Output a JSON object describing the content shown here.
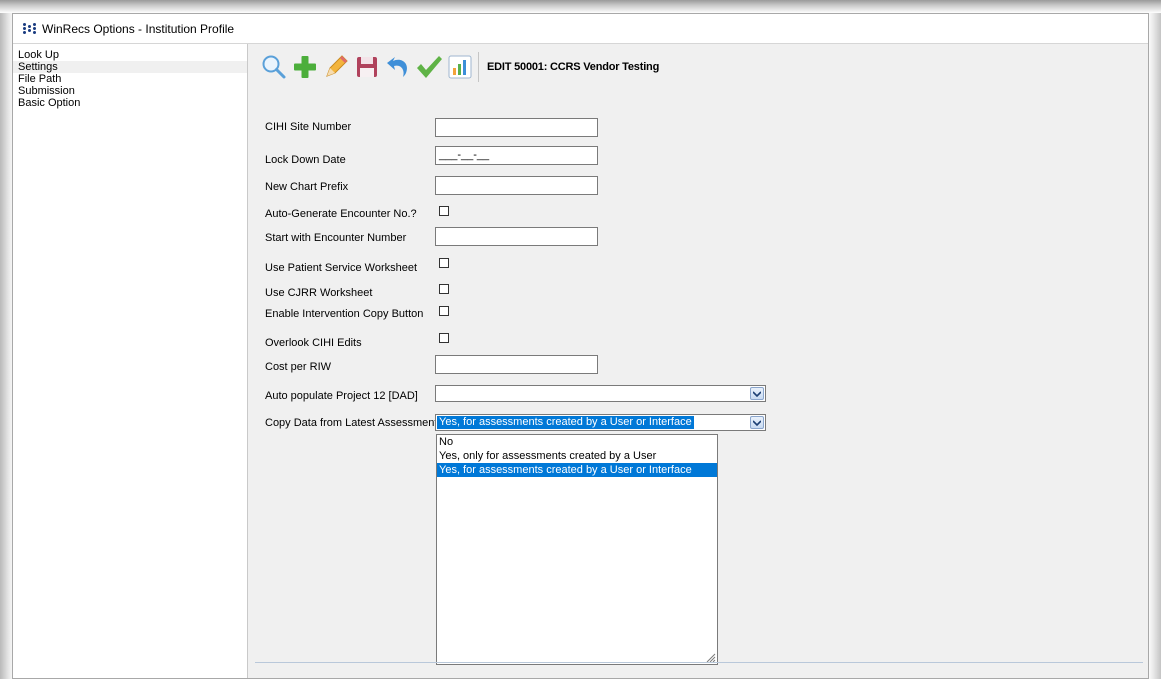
{
  "window": {
    "title": "WinRecs Options - Institution Profile"
  },
  "sidebar": {
    "items": [
      {
        "label": "Look Up"
      },
      {
        "label": "Settings"
      },
      {
        "label": "File Path"
      },
      {
        "label": "Submission"
      },
      {
        "label": "Basic Option"
      }
    ]
  },
  "toolbar": {
    "title": "EDIT 50001: CCRS Vendor Testing",
    "buttons": [
      "search-icon",
      "add-icon",
      "edit-icon",
      "save-icon",
      "undo-icon",
      "confirm-icon",
      "report-icon"
    ]
  },
  "form": {
    "cihi_site_number": {
      "label": "CIHI Site Number",
      "value": ""
    },
    "lock_down_date": {
      "label": "Lock Down Date",
      "value": "___-__-__"
    },
    "new_chart_prefix": {
      "label": "New Chart Prefix",
      "value": ""
    },
    "auto_generate": {
      "label": "Auto-Generate Encounter No.?",
      "checked": false
    },
    "start_encounter": {
      "label": "Start with Encounter Number",
      "value": ""
    },
    "patient_service": {
      "label": "Use Patient Service Worksheet",
      "checked": false
    },
    "cjrr": {
      "label": "Use CJRR Worksheet",
      "checked": false
    },
    "intervention_copy": {
      "label": "Enable Intervention Copy Button",
      "checked": false
    },
    "overlook_cihi": {
      "label": "Overlook CIHI Edits",
      "checked": false
    },
    "cost_per_riw": {
      "label": "Cost per RIW",
      "value": ""
    },
    "auto_populate": {
      "label": "Auto populate Project 12 [DAD]",
      "value": ""
    },
    "copy_data": {
      "label": "Copy Data from Latest Assessment",
      "value": "Yes, for assessments created by a User or Interface",
      "options": [
        "No",
        "Yes, only for assessments created by a User",
        "Yes, for assessments created by a User or Interface"
      ]
    }
  },
  "colors": {
    "selection": "#0078d7",
    "window_bg": "#f0f0f0"
  }
}
